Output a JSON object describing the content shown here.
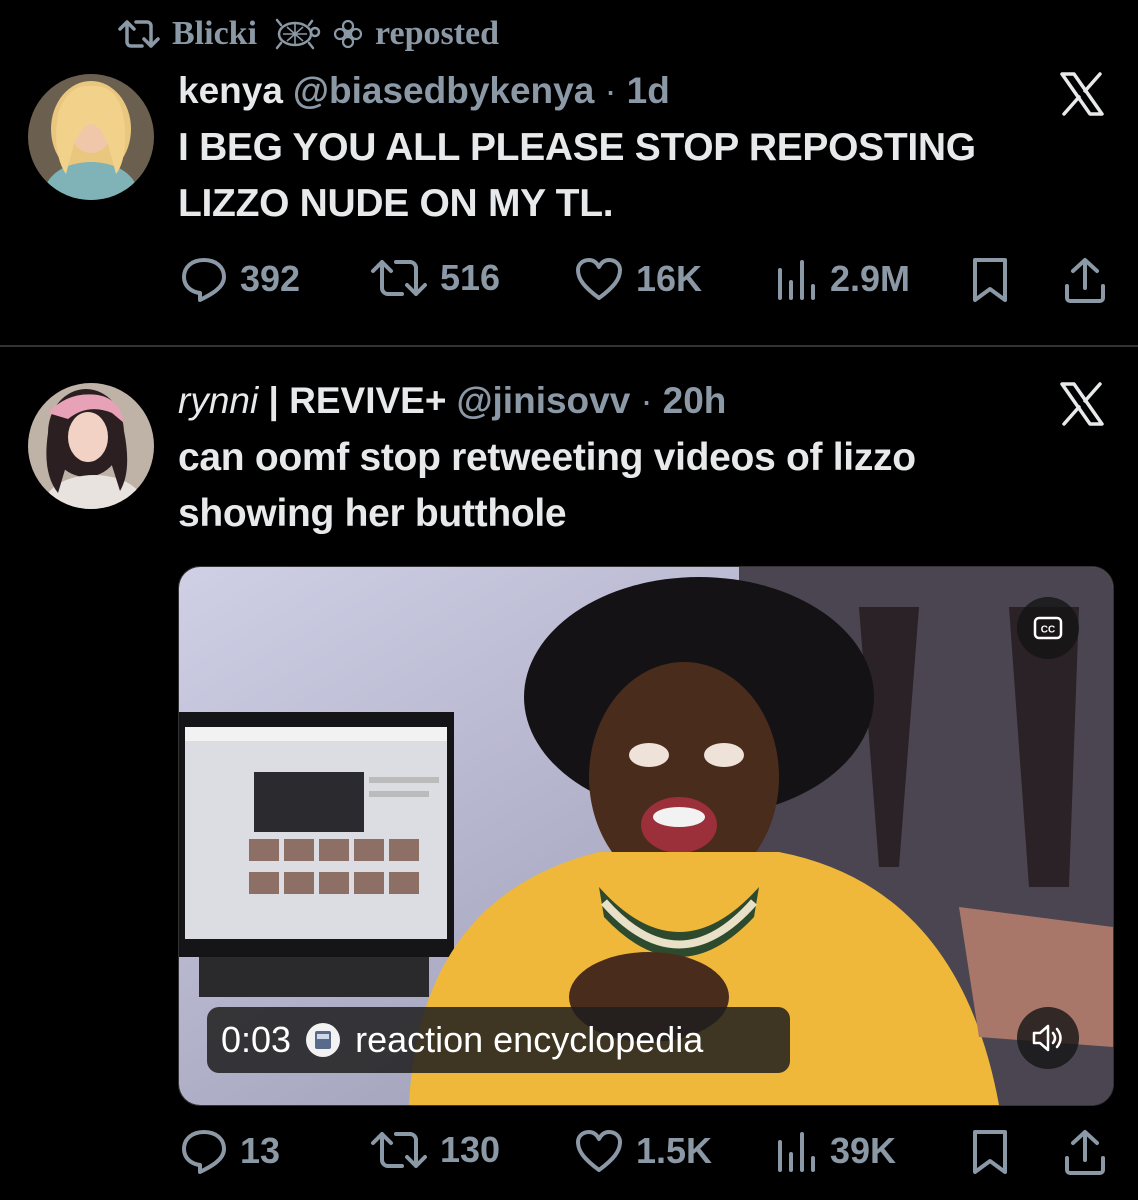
{
  "repost": {
    "user": "Blicki",
    "emoji_icons": [
      "turtle-icon",
      "flower-icon"
    ],
    "verb": "reposted"
  },
  "tweet1": {
    "display_name": "kenya",
    "handle": "@biasedbykenya",
    "separator": "·",
    "time": "1d",
    "text_line1": "I BEG YOU ALL PLEASE STOP REPOSTING",
    "text_line2": "LIZZO NUDE ON MY TL.",
    "replies": "392",
    "reposts": "516",
    "likes": "16K",
    "views": "2.9M"
  },
  "tweet2": {
    "display_name_italic": "rynni",
    "display_name_rest": "| REVIVE+",
    "handle": "@jinisovv",
    "separator": "·",
    "time": "20h",
    "text_line1": "can oomf stop retweeting videos of lizzo",
    "text_line2": "showing her butthole",
    "video": {
      "timestamp": "0:03",
      "channel": "reaction encyclopedia",
      "cc_label": "CC"
    },
    "replies": "13",
    "reposts": "130",
    "likes": "1.5K",
    "views": "39K"
  },
  "colors": {
    "background": "#000000",
    "text": "#e7e9ea",
    "muted": "#8b98a5",
    "divider": "#2f3336"
  }
}
